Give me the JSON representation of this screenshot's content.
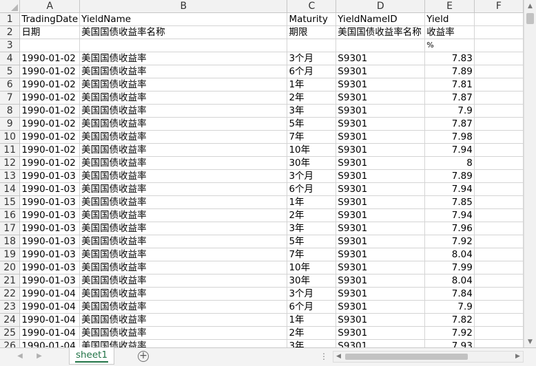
{
  "columns": [
    "A",
    "B",
    "C",
    "D",
    "E",
    "F"
  ],
  "rows": [
    {
      "n": "1",
      "a": "TradingDate",
      "b": "YieldName",
      "c": "Maturity",
      "d": "YieldNameID",
      "e": "Yield",
      "f": ""
    },
    {
      "n": "2",
      "a": "日期",
      "b": "美国国债收益率名称",
      "c": "期限",
      "d": "美国国债收益率名称",
      "e": "收益率",
      "f": ""
    },
    {
      "n": "3",
      "a": "",
      "b": "",
      "c": "",
      "d": "",
      "e": "%",
      "f": ""
    },
    {
      "n": "4",
      "a": "1990-01-02",
      "b": "美国国债收益率",
      "c": "3个月",
      "d": "S9301",
      "e": "7.83",
      "f": ""
    },
    {
      "n": "5",
      "a": "1990-01-02",
      "b": "美国国债收益率",
      "c": "6个月",
      "d": "S9301",
      "e": "7.89",
      "f": ""
    },
    {
      "n": "6",
      "a": "1990-01-02",
      "b": "美国国债收益率",
      "c": "1年",
      "d": "S9301",
      "e": "7.81",
      "f": ""
    },
    {
      "n": "7",
      "a": "1990-01-02",
      "b": "美国国债收益率",
      "c": "2年",
      "d": "S9301",
      "e": "7.87",
      "f": ""
    },
    {
      "n": "8",
      "a": "1990-01-02",
      "b": "美国国债收益率",
      "c": "3年",
      "d": "S9301",
      "e": "7.9",
      "f": ""
    },
    {
      "n": "9",
      "a": "1990-01-02",
      "b": "美国国债收益率",
      "c": "5年",
      "d": "S9301",
      "e": "7.87",
      "f": ""
    },
    {
      "n": "10",
      "a": "1990-01-02",
      "b": "美国国债收益率",
      "c": "7年",
      "d": "S9301",
      "e": "7.98",
      "f": ""
    },
    {
      "n": "11",
      "a": "1990-01-02",
      "b": "美国国债收益率",
      "c": "10年",
      "d": "S9301",
      "e": "7.94",
      "f": ""
    },
    {
      "n": "12",
      "a": "1990-01-02",
      "b": "美国国债收益率",
      "c": "30年",
      "d": "S9301",
      "e": "8",
      "f": ""
    },
    {
      "n": "13",
      "a": "1990-01-03",
      "b": "美国国债收益率",
      "c": "3个月",
      "d": "S9301",
      "e": "7.89",
      "f": ""
    },
    {
      "n": "14",
      "a": "1990-01-03",
      "b": "美国国债收益率",
      "c": "6个月",
      "d": "S9301",
      "e": "7.94",
      "f": ""
    },
    {
      "n": "15",
      "a": "1990-01-03",
      "b": "美国国债收益率",
      "c": "1年",
      "d": "S9301",
      "e": "7.85",
      "f": ""
    },
    {
      "n": "16",
      "a": "1990-01-03",
      "b": "美国国债收益率",
      "c": "2年",
      "d": "S9301",
      "e": "7.94",
      "f": ""
    },
    {
      "n": "17",
      "a": "1990-01-03",
      "b": "美国国债收益率",
      "c": "3年",
      "d": "S9301",
      "e": "7.96",
      "f": ""
    },
    {
      "n": "18",
      "a": "1990-01-03",
      "b": "美国国债收益率",
      "c": "5年",
      "d": "S9301",
      "e": "7.92",
      "f": ""
    },
    {
      "n": "19",
      "a": "1990-01-03",
      "b": "美国国债收益率",
      "c": "7年",
      "d": "S9301",
      "e": "8.04",
      "f": ""
    },
    {
      "n": "20",
      "a": "1990-01-03",
      "b": "美国国债收益率",
      "c": "10年",
      "d": "S9301",
      "e": "7.99",
      "f": ""
    },
    {
      "n": "21",
      "a": "1990-01-03",
      "b": "美国国债收益率",
      "c": "30年",
      "d": "S9301",
      "e": "8.04",
      "f": ""
    },
    {
      "n": "22",
      "a": "1990-01-04",
      "b": "美国国债收益率",
      "c": "3个月",
      "d": "S9301",
      "e": "7.84",
      "f": ""
    },
    {
      "n": "23",
      "a": "1990-01-04",
      "b": "美国国债收益率",
      "c": "6个月",
      "d": "S9301",
      "e": "7.9",
      "f": ""
    },
    {
      "n": "24",
      "a": "1990-01-04",
      "b": "美国国债收益率",
      "c": "1年",
      "d": "S9301",
      "e": "7.82",
      "f": ""
    },
    {
      "n": "25",
      "a": "1990-01-04",
      "b": "美国国债收益率",
      "c": "2年",
      "d": "S9301",
      "e": "7.92",
      "f": ""
    },
    {
      "n": "26",
      "a": "1990-01-04",
      "b": "美国国债收益率",
      "c": "3年",
      "d": "S9301",
      "e": "7.93",
      "f": ""
    }
  ],
  "sheet_tab": "sheet1",
  "add_sheet_symbol": "+",
  "icons": {
    "add": "plus-circle-icon",
    "select_all": "select-all-triangle-icon"
  }
}
